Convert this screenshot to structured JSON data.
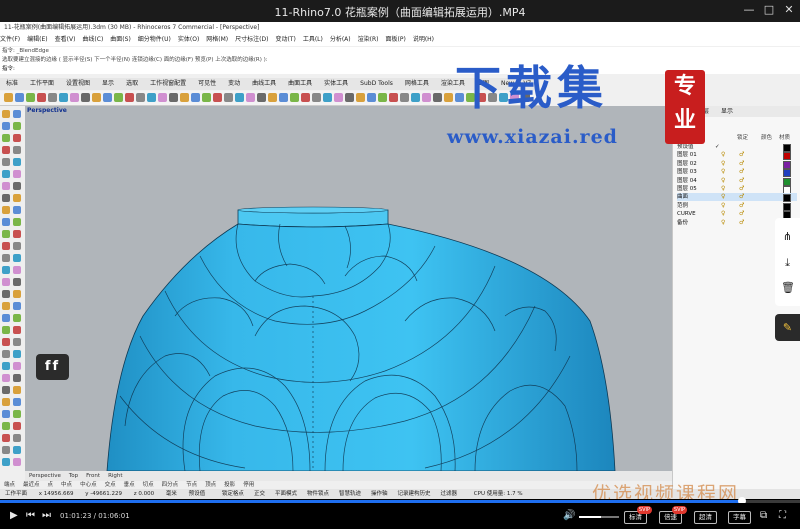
{
  "player": {
    "title": "11-Rhino7.0 花瓶案例（曲面编辑拓展运用）.MP4",
    "current_time": "01:01:23",
    "total_time": "01:06:01",
    "progress": 0.928,
    "volume": 0.55,
    "buttons": [
      {
        "label": "标清",
        "badge": "SVIP"
      },
      {
        "label": "倍速",
        "badge": "SVIP"
      },
      {
        "label": "超清",
        "badge": ""
      },
      {
        "label": "字幕",
        "badge": ""
      }
    ]
  },
  "window_controls": {
    "minimize": "—",
    "restore": "□",
    "close": "✕"
  },
  "rhino": {
    "title_bar": "11-花瓶案例(曲面编辑拓展运用).3dm (30 MB) - Rhinoceros 7 Commercial - [Perspective]",
    "menu": [
      "文件(F)",
      "编辑(E)",
      "查看(V)",
      "曲线(C)",
      "曲面(S)",
      "细分物件(U)",
      "实体(O)",
      "网格(M)",
      "尺寸标注(D)",
      "变动(T)",
      "工具(L)",
      "分析(A)",
      "渲染(R)",
      "面板(P)",
      "说明(H)"
    ],
    "command_history_1": "指令: _BlendEdge",
    "command_history_2": "选取要建立混接的边缘 ( 显示半径(S) 下一个半径(N) 连锁边缘(C) 面的边缘(F) 预览(P) 上次选取的边缘(R) ):",
    "command_prompt": "指令:",
    "tabs": [
      "标准",
      "工作平面",
      "设置视图",
      "显示",
      "选取",
      "工作视窗配置",
      "可见性",
      "变动",
      "曲线工具",
      "曲面工具",
      "实体工具",
      "SubD Tools",
      "网格工具",
      "渲染工具",
      "出图",
      "New in V7"
    ],
    "viewport_label": "Perspective",
    "view_tabs": [
      "Perspective",
      "Top",
      "Front",
      "Right"
    ],
    "osnaps": [
      "端点",
      "最近点",
      "点",
      "中点",
      "中心点",
      "交点",
      "垂点",
      "切点",
      "四分点",
      "节点",
      "顶点",
      "投影",
      "停用"
    ],
    "status": {
      "cplane": "工作平面",
      "x": "x 14956.669",
      "y": "y -49661.229",
      "z": "z 0.000",
      "unit": "毫米",
      "layer": "预设值",
      "items": [
        "锁定格点",
        "正交",
        "平面模式",
        "物件锁点",
        "智慧轨迹",
        "操作轴",
        "记录建构历史",
        "过滤器"
      ],
      "cpu": "CPU 使用量: 1.7 %"
    }
  },
  "layers": {
    "tabs": [
      "图层",
      "显示"
    ],
    "header": {
      "name": "图层",
      "material": "材质",
      "lock": "锁定",
      "color": "颜色"
    },
    "rows": [
      {
        "name": "预设值",
        "current": true,
        "color": "#000000",
        "selected": false
      },
      {
        "name": "图层 01",
        "current": false,
        "color": "#c00000",
        "selected": false
      },
      {
        "name": "图层 02",
        "current": false,
        "color": "#7a1fa2",
        "selected": false
      },
      {
        "name": "图层 03",
        "current": false,
        "color": "#1f3fbf",
        "selected": false
      },
      {
        "name": "图层 04",
        "current": false,
        "color": "#1f8f2f",
        "selected": false
      },
      {
        "name": "图层 05",
        "current": false,
        "color": "#ffffff",
        "selected": false
      },
      {
        "name": "曲面",
        "current": false,
        "color": "#000000",
        "selected": true
      },
      {
        "name": "范例",
        "current": false,
        "color": "#000000",
        "selected": false
      },
      {
        "name": "CURVE",
        "current": false,
        "color": "#000000",
        "selected": false
      },
      {
        "name": "备份",
        "current": false,
        "color": "#000000",
        "selected": false
      }
    ]
  },
  "watermark": {
    "main": "下载集",
    "seal": "专业",
    "url": "www.xiazai.red",
    "bottom": "优选视频课程网",
    "badge": "ff"
  }
}
